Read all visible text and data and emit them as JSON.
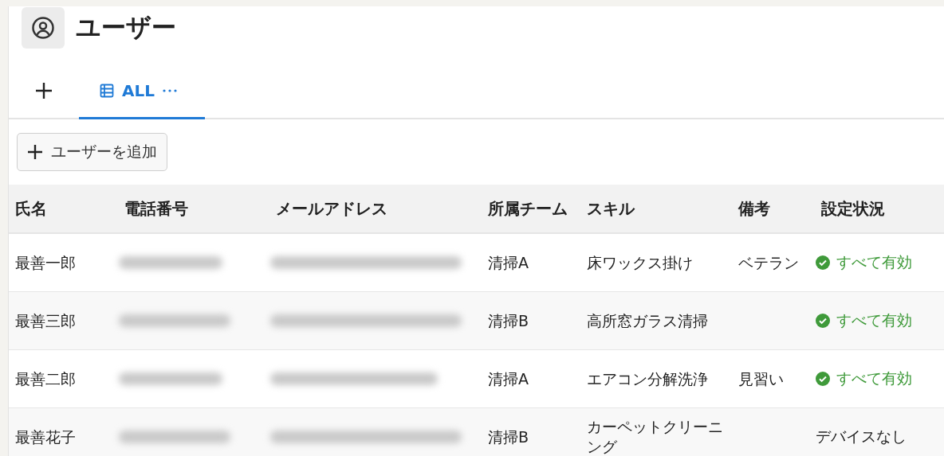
{
  "page": {
    "title": "ユーザー"
  },
  "tabs": [
    {
      "label": "ALL",
      "selected": true
    }
  ],
  "add_button": {
    "label": "ユーザーを追加"
  },
  "table": {
    "columns": [
      "氏名",
      "電話番号",
      "メールアドレス",
      "所属チーム",
      "スキル",
      "備考",
      "設定状況"
    ],
    "rows": [
      {
        "name": "最善一郎",
        "phone_blurred": true,
        "email_blurred": true,
        "team": "清掃A",
        "skill": "床ワックス掛け",
        "note": "ベテラン",
        "status": {
          "kind": "ok",
          "text": "すべて有効"
        }
      },
      {
        "name": "最善三郎",
        "phone_blurred": true,
        "email_blurred": true,
        "team": "清掃B",
        "skill": "高所窓ガラス清掃",
        "status": {
          "kind": "ok",
          "text": "すべて有効"
        }
      },
      {
        "name": "最善二郎",
        "phone_blurred": true,
        "email_blurred": true,
        "team": "清掃A",
        "skill": "エアコン分解洗浄",
        "note": "見習い",
        "status": {
          "kind": "ok",
          "text": "すべて有効"
        }
      },
      {
        "name": "最善花子",
        "phone_blurred": true,
        "email_blurred": true,
        "team": "清掃B",
        "skill": "カーペットクリーニング",
        "status": {
          "kind": "none",
          "text": "デバイスなし"
        }
      }
    ]
  }
}
